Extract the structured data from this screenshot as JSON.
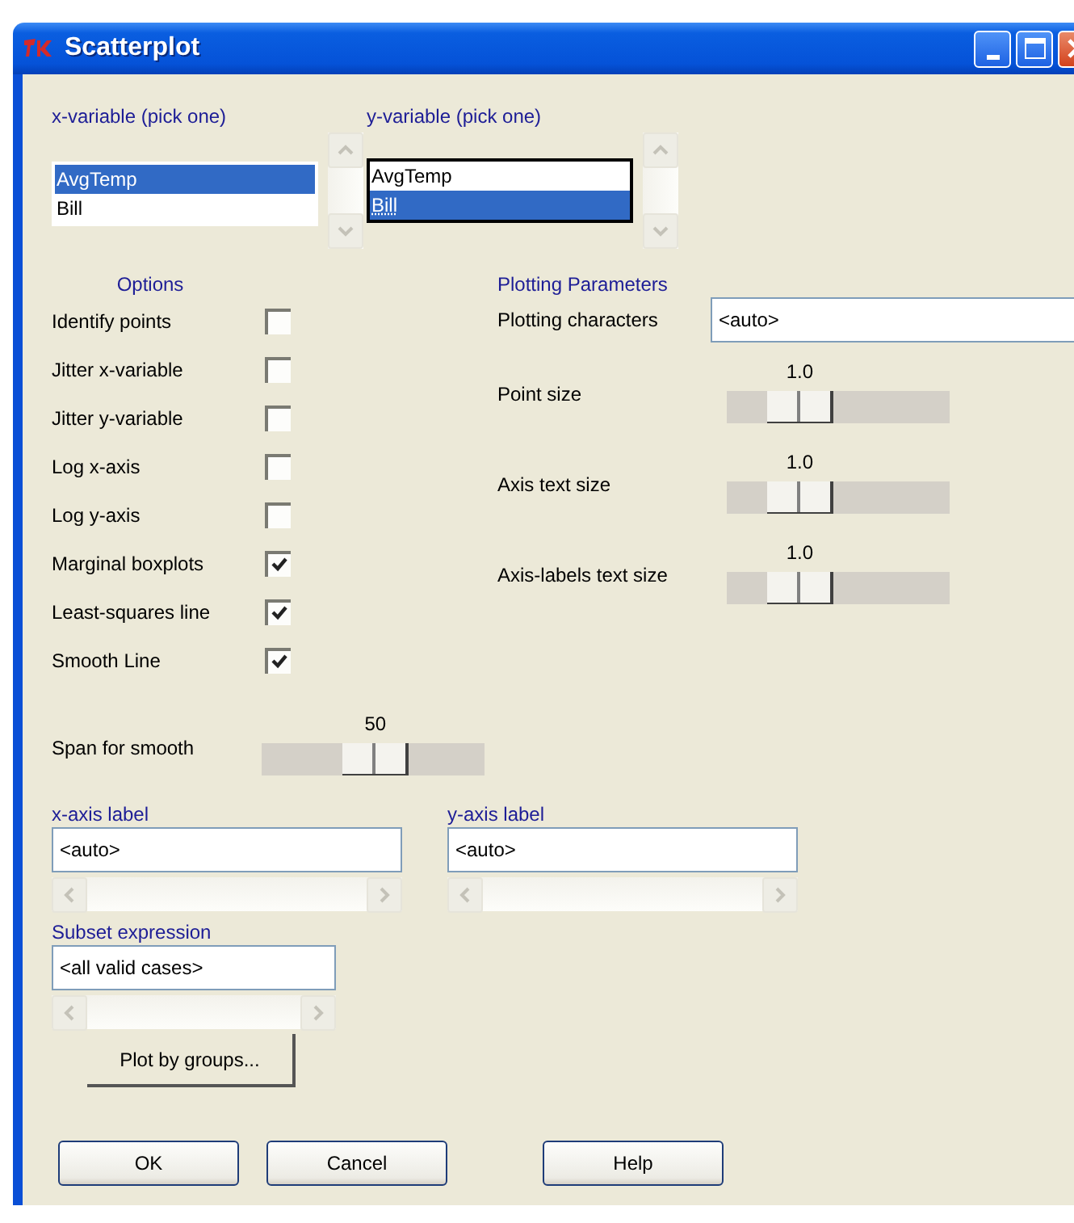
{
  "window": {
    "title": "Scatterplot"
  },
  "variable_lists": [
    {
      "heading": "x-variable (pick one)",
      "focused": false,
      "items": [
        {
          "label": "AvgTemp",
          "selected": true
        },
        {
          "label": "Bill",
          "selected": false
        }
      ]
    },
    {
      "heading": "y-variable (pick one)",
      "focused": true,
      "items": [
        {
          "label": "AvgTemp",
          "selected": false
        },
        {
          "label": "Bill",
          "selected": true
        }
      ]
    }
  ],
  "options": {
    "heading": "Options",
    "items": [
      {
        "label": "Identify points",
        "checked": false
      },
      {
        "label": "Jitter x-variable",
        "checked": false
      },
      {
        "label": "Jitter y-variable",
        "checked": false
      },
      {
        "label": "Log x-axis",
        "checked": false
      },
      {
        "label": "Log y-axis",
        "checked": false
      },
      {
        "label": "Marginal boxplots",
        "checked": true
      },
      {
        "label": "Least-squares line",
        "checked": true
      },
      {
        "label": "Smooth Line",
        "checked": true
      }
    ],
    "span": {
      "label": "Span for smooth",
      "value": "50",
      "level": 0.52
    }
  },
  "plotting_parameters": {
    "heading": "Plotting Parameters",
    "plotting_characters": {
      "label": "Plotting characters",
      "value": "<auto>"
    },
    "sliders": [
      {
        "label": "Point size",
        "value": "1.0",
        "level": 0.26
      },
      {
        "label": "Axis text size",
        "value": "1.0",
        "level": 0.26
      },
      {
        "label": "Axis-labels text size",
        "value": "1.0",
        "level": 0.26
      }
    ]
  },
  "axis_labels": [
    {
      "heading": "x-axis label",
      "value": "<auto>"
    },
    {
      "heading": "y-axis label",
      "value": "<auto>"
    }
  ],
  "subset": {
    "heading": "Subset expression",
    "value": "<all valid cases>"
  },
  "plot_by_groups_button": "Plot by groups...",
  "buttons": [
    "OK",
    "Cancel",
    "Help"
  ]
}
